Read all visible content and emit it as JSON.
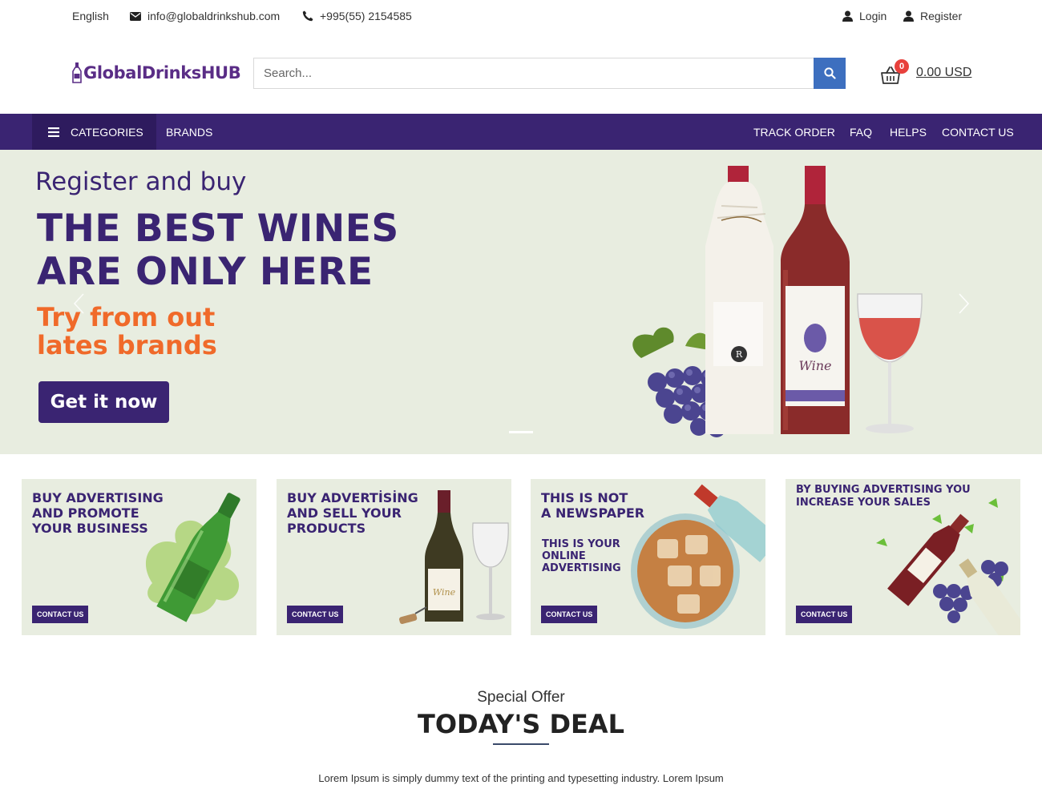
{
  "topbar": {
    "language": "English",
    "email": "info@globaldrinkshub.com",
    "phone": "+995(55) 2154585",
    "login_label": "Login",
    "register_label": "Register",
    "icons": [
      "envelope-icon",
      "phone-icon",
      "user-icon"
    ]
  },
  "header": {
    "logo_text": "GlobalDrinksHUB",
    "search_placeholder": "Search...",
    "cart_count": "0",
    "cart_total": "0.00 USD",
    "icons": [
      "bottle-logo-icon",
      "search-icon",
      "basket-icon"
    ]
  },
  "nav": {
    "categories_label": "CATEGORIES",
    "brands_label": "BRANDS",
    "links": [
      "TRACK ORDER",
      "FAQ",
      "HELPS",
      "CONTACT US"
    ]
  },
  "hero": {
    "subtitle": "Register and buy",
    "title_lines": [
      "THE BEST WINES",
      "ARE ONLY HERE"
    ],
    "accent_lines": [
      "Try from out",
      "lates brands"
    ],
    "button_label": "Get it now"
  },
  "promos": [
    {
      "title_lines": [
        "BUY ADVERTISING",
        "AND PROMOTE",
        "YOUR BUSINESS"
      ],
      "sub_lines": [],
      "button_label": "CONTACT US"
    },
    {
      "title_lines": [
        "BUY ADVERTİSİNG",
        "AND SELL YOUR",
        "PRODUCTS"
      ],
      "sub_lines": [],
      "button_label": "CONTACT US"
    },
    {
      "title_lines": [
        "THIS IS NOT",
        "A NEWSPAPER"
      ],
      "sub_lines": [
        "THIS IS YOUR",
        "ONLINE",
        "ADVERTISING"
      ],
      "button_label": "CONTACT US"
    },
    {
      "title_lines": [
        "BY BUYING ADVERTISING YOU",
        "INCREASE YOUR SALES"
      ],
      "sub_lines": [],
      "button_label": "CONTACT US"
    }
  ],
  "deal": {
    "kicker": "Special Offer",
    "title": "TODAY'S DEAL",
    "description": "Lorem Ipsum is simply dummy text of the printing and typesetting industry. Lorem Ipsum"
  },
  "colors": {
    "brand_purple": "#3a2472",
    "accent_orange": "#f06a2a",
    "search_blue": "#3d6fbf",
    "badge_red": "#e8413c",
    "hero_bg": "#e8ede0"
  }
}
